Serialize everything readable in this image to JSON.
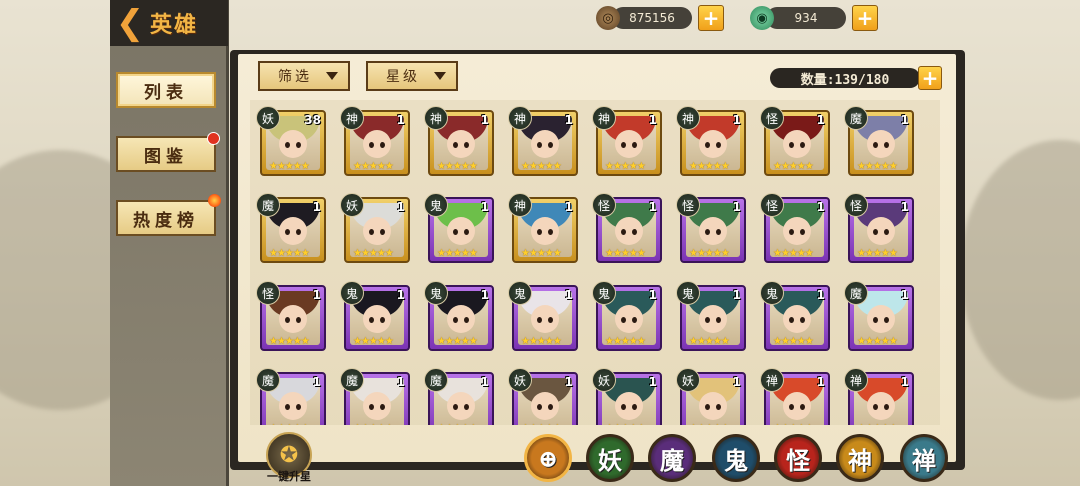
{
  "header": {
    "title": "英雄"
  },
  "sidebar": {
    "items": [
      {
        "label": "列表",
        "active": true
      },
      {
        "label": "图鉴",
        "badge": "red-dot"
      },
      {
        "label": "热度榜",
        "badge": "fire-icon"
      }
    ]
  },
  "currency": [
    {
      "icon": "coin-icon",
      "value": "875156"
    },
    {
      "icon": "jade-icon",
      "value": "934"
    }
  ],
  "filters": {
    "filter_label": "筛选",
    "star_label": "星级"
  },
  "count": {
    "text": "数量:139/180"
  },
  "heroes": [
    {
      "faction": "妖",
      "level": "38",
      "stars": 5,
      "frame": "gold",
      "hair": "#c9c37a"
    },
    {
      "faction": "神",
      "level": "1",
      "stars": 5,
      "frame": "gold",
      "hair": "#8a2a2a"
    },
    {
      "faction": "神",
      "level": "1",
      "stars": 5,
      "frame": "gold",
      "hair": "#8a2a2a"
    },
    {
      "faction": "神",
      "level": "1",
      "stars": 5,
      "frame": "gold",
      "hair": "#2a2230"
    },
    {
      "faction": "神",
      "level": "1",
      "stars": 5,
      "frame": "gold",
      "hair": "#c23a2a"
    },
    {
      "faction": "神",
      "level": "1",
      "stars": 5,
      "frame": "gold",
      "hair": "#c23a2a"
    },
    {
      "faction": "怪",
      "level": "1",
      "stars": 5,
      "frame": "gold",
      "hair": "#7a1a18"
    },
    {
      "faction": "魔",
      "level": "1",
      "stars": 5,
      "frame": "gold",
      "hair": "#7d7fa8"
    },
    {
      "faction": "魔",
      "level": "1",
      "stars": 5,
      "frame": "gold",
      "hair": "#1e1b22"
    },
    {
      "faction": "妖",
      "level": "1",
      "stars": 5,
      "frame": "gold",
      "hair": "#dcdcd8"
    },
    {
      "faction": "鬼",
      "level": "1",
      "stars": 5,
      "frame": "purple",
      "hair": "#6dbf4a"
    },
    {
      "faction": "神",
      "level": "1",
      "stars": 5,
      "frame": "gold",
      "hair": "#3f88b8"
    },
    {
      "faction": "怪",
      "level": "1",
      "stars": 5,
      "frame": "purple",
      "hair": "#3f7a4a"
    },
    {
      "faction": "怪",
      "level": "1",
      "stars": 5,
      "frame": "purple",
      "hair": "#3f7a4a"
    },
    {
      "faction": "怪",
      "level": "1",
      "stars": 5,
      "frame": "purple",
      "hair": "#3f7a4a"
    },
    {
      "faction": "怪",
      "level": "1",
      "stars": 5,
      "frame": "purple",
      "hair": "#5a3a7a"
    },
    {
      "faction": "怪",
      "level": "1",
      "stars": 5,
      "frame": "purple",
      "hair": "#6a3a22"
    },
    {
      "faction": "鬼",
      "level": "1",
      "stars": 5,
      "frame": "purple",
      "hair": "#1a1820"
    },
    {
      "faction": "鬼",
      "level": "1",
      "stars": 5,
      "frame": "purple",
      "hair": "#1a1820"
    },
    {
      "faction": "鬼",
      "level": "1",
      "stars": 5,
      "frame": "purple",
      "hair": "#e9e4e8"
    },
    {
      "faction": "鬼",
      "level": "1",
      "stars": 5,
      "frame": "purple",
      "hair": "#2a5a5a"
    },
    {
      "faction": "鬼",
      "level": "1",
      "stars": 5,
      "frame": "purple",
      "hair": "#2a5a5a"
    },
    {
      "faction": "鬼",
      "level": "1",
      "stars": 5,
      "frame": "purple",
      "hair": "#2a5a5a"
    },
    {
      "faction": "魔",
      "level": "1",
      "stars": 5,
      "frame": "purple",
      "hair": "#bde6ea"
    },
    {
      "faction": "魔",
      "level": "1",
      "stars": 5,
      "frame": "purple",
      "hair": "#d8d8dc"
    },
    {
      "faction": "魔",
      "level": "1",
      "stars": 5,
      "frame": "purple",
      "hair": "#e8e2dc"
    },
    {
      "faction": "魔",
      "level": "1",
      "stars": 5,
      "frame": "purple",
      "hair": "#e8e2dc"
    },
    {
      "faction": "妖",
      "level": "1",
      "stars": 5,
      "frame": "purple",
      "hair": "#6a5640"
    },
    {
      "faction": "妖",
      "level": "1",
      "stars": 5,
      "frame": "purple",
      "hair": "#2a5450"
    },
    {
      "faction": "妖",
      "level": "1",
      "stars": 5,
      "frame": "purple",
      "hair": "#e2c27a"
    },
    {
      "faction": "禅",
      "level": "1",
      "stars": 5,
      "frame": "purple",
      "hair": "#d84a2a"
    },
    {
      "faction": "禅",
      "level": "1",
      "stars": 5,
      "frame": "purple",
      "hair": "#d84a2a"
    }
  ],
  "bottom": {
    "upgrade_label": "一键升星",
    "tabs": [
      {
        "label": "",
        "icon": "all-factions-icon",
        "color": "#c8781e"
      },
      {
        "label": "妖",
        "color": "#2f6a2c"
      },
      {
        "label": "魔",
        "color": "#5a2d7a"
      },
      {
        "label": "鬼",
        "color": "#1f4d6a"
      },
      {
        "label": "怪",
        "color": "#b8241c"
      },
      {
        "label": "神",
        "color": "#c88a1a"
      },
      {
        "label": "禅",
        "color": "#3a7a8a"
      }
    ]
  }
}
